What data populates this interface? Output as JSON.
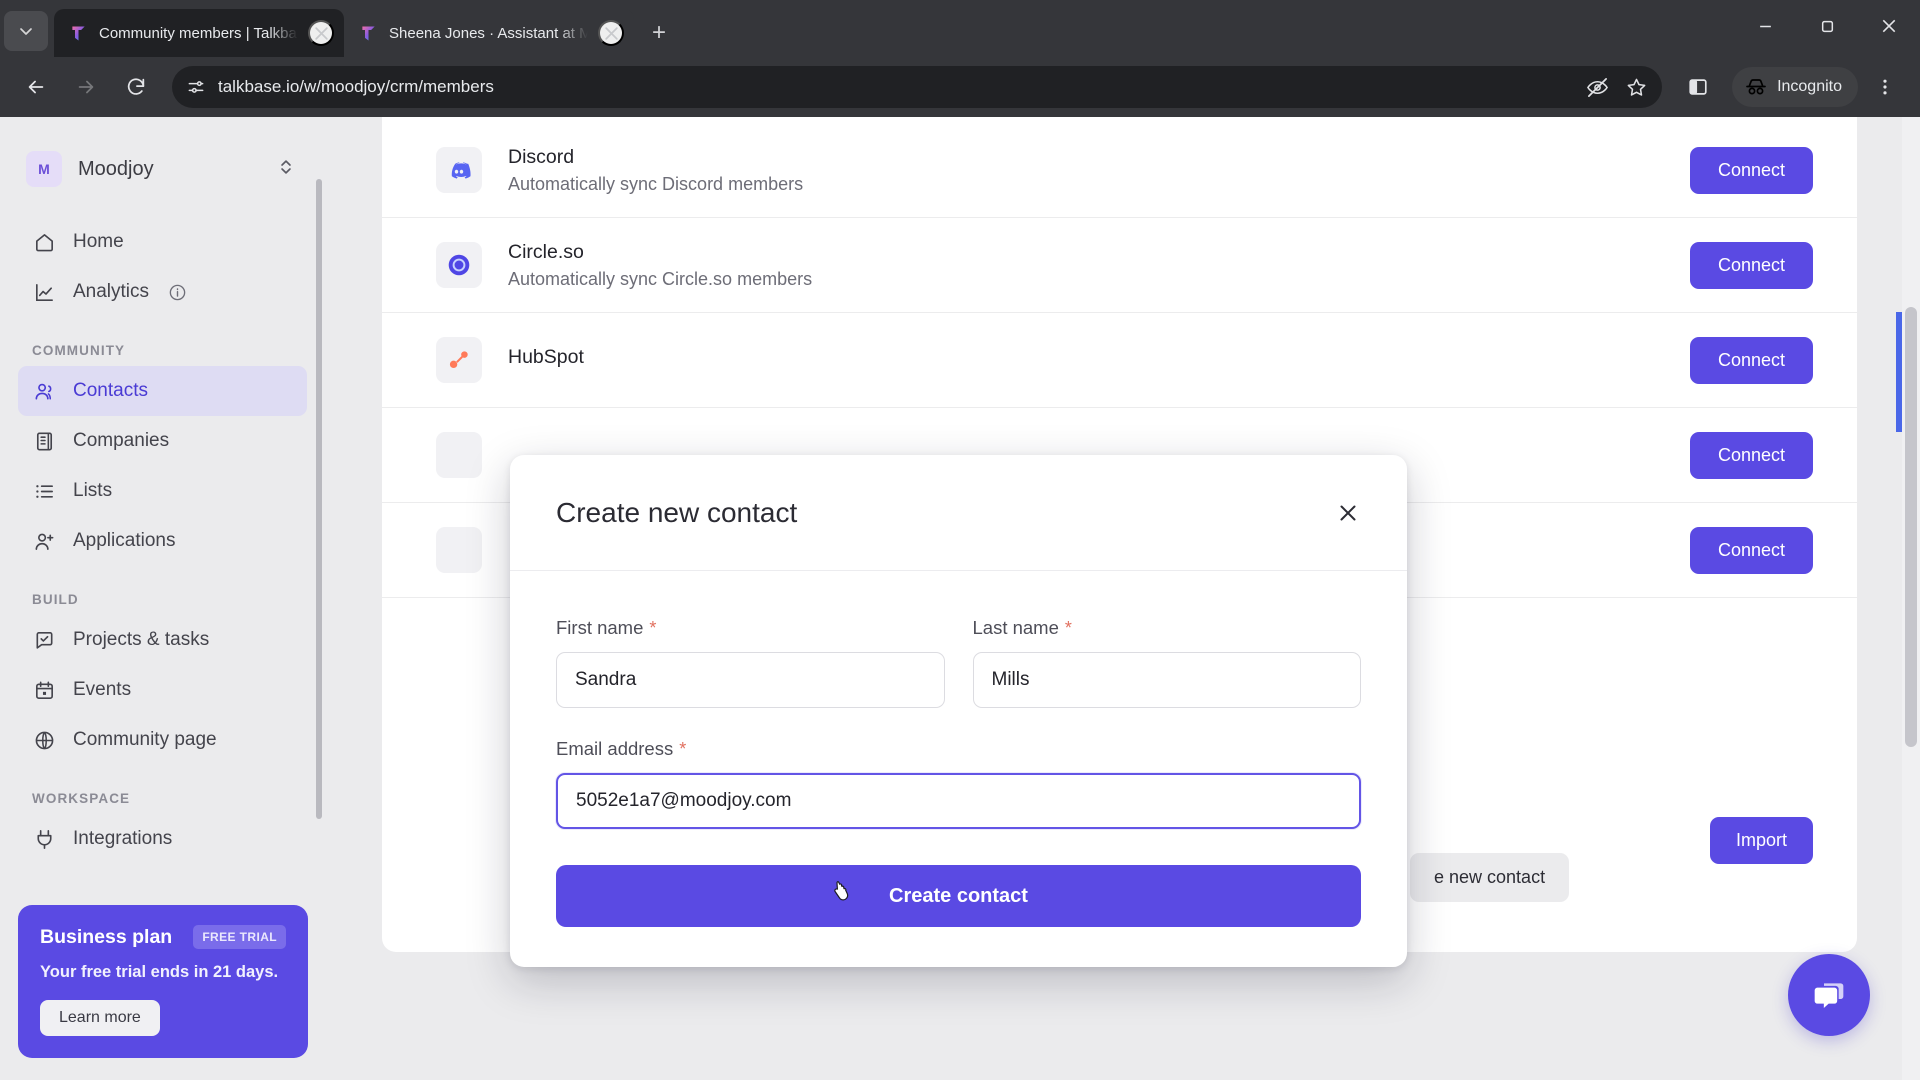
{
  "browser": {
    "tabs": [
      {
        "title": "Community members | Talkbase",
        "active": true,
        "favicon": "talkbase-logo-icon"
      },
      {
        "title": "Sheena Jones · Assistant at Moo",
        "active": false,
        "favicon": "talkbase-logo-icon"
      }
    ],
    "new_tab_label": "+",
    "url": "talkbase.io/w/moodjoy/crm/members",
    "profile_label": "Incognito",
    "window_controls": {
      "minimize": "–",
      "maximize": "▢",
      "close": "✕"
    }
  },
  "sidebar": {
    "workspace": {
      "initial": "M",
      "name": "Moodjoy"
    },
    "nav": [
      {
        "label": "Home",
        "icon": "home-icon",
        "active": false
      },
      {
        "label": "Analytics",
        "icon": "chart-line-icon",
        "active": false,
        "info": true
      }
    ],
    "groups": [
      {
        "title": "COMMUNITY",
        "items": [
          {
            "label": "Contacts",
            "icon": "users-icon",
            "active": true
          },
          {
            "label": "Companies",
            "icon": "building-icon",
            "active": false
          },
          {
            "label": "Lists",
            "icon": "list-icon",
            "active": false
          },
          {
            "label": "Applications",
            "icon": "user-plus-icon",
            "active": false
          }
        ]
      },
      {
        "title": "BUILD",
        "items": [
          {
            "label": "Projects & tasks",
            "icon": "check-square-icon",
            "active": false
          },
          {
            "label": "Events",
            "icon": "calendar-icon",
            "active": false
          },
          {
            "label": "Community page",
            "icon": "globe-icon",
            "active": false
          }
        ]
      },
      {
        "title": "WORKSPACE",
        "items": [
          {
            "label": "Integrations",
            "icon": "plug-icon",
            "active": false
          }
        ]
      }
    ],
    "plan_card": {
      "title": "Business plan",
      "badge": "FREE TRIAL",
      "subtitle": "Your free trial ends in 21 days.",
      "button": "Learn more"
    }
  },
  "main": {
    "integrations": [
      {
        "name": "Discord",
        "desc": "Automatically sync Discord members",
        "action": "Connect",
        "logo": "discord-icon"
      },
      {
        "name": "Circle.so",
        "desc": "Automatically sync Circle.so members",
        "action": "Connect",
        "logo": "circle-so-icon"
      },
      {
        "name": "HubSpot",
        "desc": "",
        "action": "Connect",
        "logo": "hubspot-icon"
      },
      {
        "name": "",
        "desc": "",
        "action": "Connect",
        "logo": "integration-icon"
      },
      {
        "name": "",
        "desc": "",
        "action": "Connect",
        "logo": "integration-icon"
      }
    ],
    "import_button": "Import",
    "create_contact_button": "e new contact"
  },
  "modal": {
    "title": "Create new contact",
    "close_label": "✕",
    "fields": {
      "first_name": {
        "label": "First name",
        "required_mark": "*",
        "value": "Sandra",
        "placeholder": ""
      },
      "last_name": {
        "label": "Last name",
        "required_mark": "*",
        "value": "Mills",
        "placeholder": ""
      },
      "email": {
        "label": "Email address",
        "required_mark": "*",
        "value": "5052e1a7@moodjoy.com",
        "placeholder": ""
      }
    },
    "submit": "Create contact"
  },
  "colors": {
    "accent": "#5a4ae3",
    "accent_soft": "#dedcf3",
    "page_bg": "#ebebed",
    "chrome_bg": "#35363a",
    "required": "#e1705f"
  }
}
